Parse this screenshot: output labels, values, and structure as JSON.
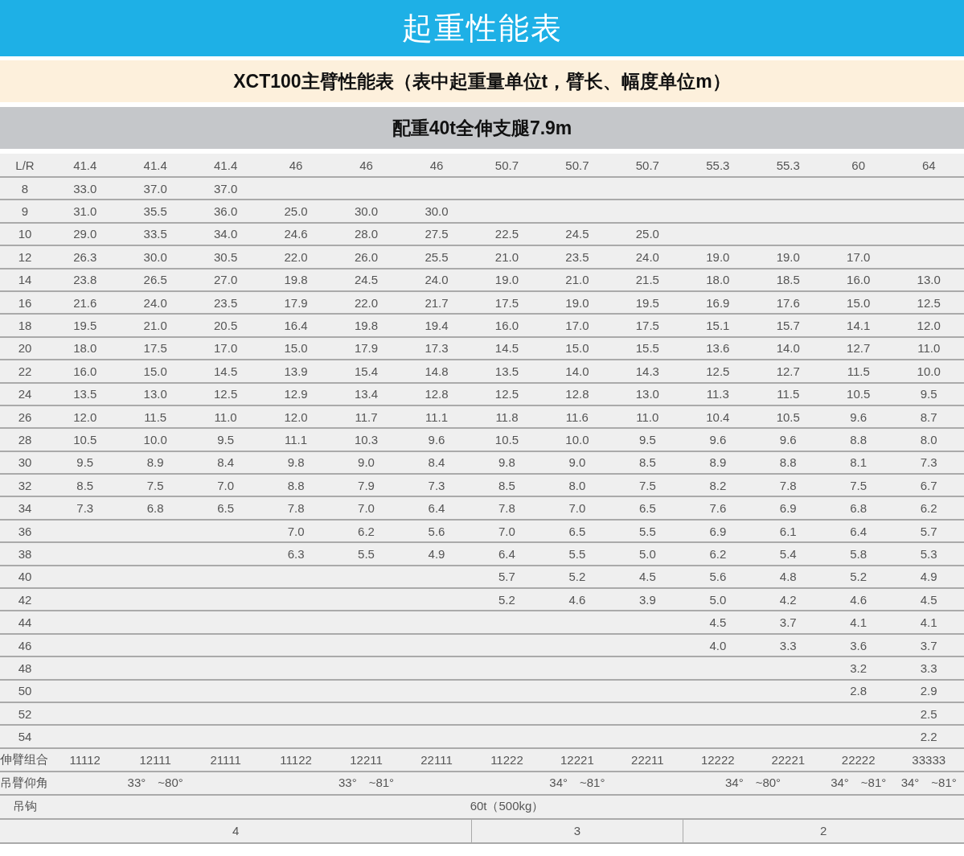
{
  "title": "起重性能表",
  "subtitle": "XCT100主臂性能表（表中起重量单位t，臂长、幅度单位m）",
  "condition": "配重40t全伸支腿7.9m",
  "table": {
    "corner": "L/R",
    "boom_lengths": [
      "41.4",
      "41.4",
      "41.4",
      "46",
      "46",
      "46",
      "50.7",
      "50.7",
      "50.7",
      "55.3",
      "55.3",
      "60",
      "64"
    ],
    "rows": [
      {
        "radius": "8",
        "values": {
          "column_1": "33.0",
          "column_2": "37.0",
          "column_3": "37.0"
        }
      },
      {
        "radius": "9",
        "values": {
          "column_1": "31.0",
          "column_2": "35.5",
          "column_3": "36.0",
          "column_4": "25.0",
          "column_5": "30.0",
          "column_6": "30.0"
        }
      },
      {
        "radius": "10",
        "values": {
          "column_1": "29.0",
          "column_2": "33.5",
          "column_3": "34.0",
          "column_4": "24.6",
          "column_5": "28.0",
          "column_6": "27.5",
          "column_7": "22.5",
          "column_8": "24.5",
          "column_9": "25.0"
        }
      },
      {
        "radius": "12",
        "values": {
          "column_1": "26.3",
          "column_2": "30.0",
          "column_3": "30.5",
          "column_4": "22.0",
          "column_5": "26.0",
          "column_6": "25.5",
          "column_7": "21.0",
          "column_8": "23.5",
          "column_9": "24.0",
          "column_10": "19.0",
          "column_11": "19.0",
          "column_12": "17.0"
        }
      },
      {
        "radius": "14",
        "values": {
          "column_1": "23.8",
          "column_2": "26.5",
          "column_3": "27.0",
          "column_4": "19.8",
          "column_5": "24.5",
          "column_6": "24.0",
          "column_7": "19.0",
          "column_8": "21.0",
          "column_9": "21.5",
          "column_10": "18.0",
          "column_11": "18.5",
          "column_12": "16.0",
          "column_13": "13.0"
        }
      },
      {
        "radius": "16",
        "values": {
          "column_1": "21.6",
          "column_2": "24.0",
          "column_3": "23.5",
          "column_4": "17.9",
          "column_5": "22.0",
          "column_6": "21.7",
          "column_7": "17.5",
          "column_8": "19.0",
          "column_9": "19.5",
          "column_10": "16.9",
          "column_11": "17.6",
          "column_12": "15.0",
          "column_13": "12.5"
        }
      },
      {
        "radius": "18",
        "values": {
          "column_1": "19.5",
          "column_2": "21.0",
          "column_3": "20.5",
          "column_4": "16.4",
          "column_5": "19.8",
          "column_6": "19.4",
          "column_7": "16.0",
          "column_8": "17.0",
          "column_9": "17.5",
          "column_10": "15.1",
          "column_11": "15.7",
          "column_12": "14.1",
          "column_13": "12.0"
        }
      },
      {
        "radius": "20",
        "values": {
          "column_1": "18.0",
          "column_2": "17.5",
          "column_3": "17.0",
          "column_4": "15.0",
          "column_5": "17.9",
          "column_6": "17.3",
          "column_7": "14.5",
          "column_8": "15.0",
          "column_9": "15.5",
          "column_10": "13.6",
          "column_11": "14.0",
          "column_12": "12.7",
          "column_13": "11.0"
        }
      },
      {
        "radius": "22",
        "values": {
          "column_1": "16.0",
          "column_2": "15.0",
          "column_3": "14.5",
          "column_4": "13.9",
          "column_5": "15.4",
          "column_6": "14.8",
          "column_7": "13.5",
          "column_8": "14.0",
          "column_9": "14.3",
          "column_10": "12.5",
          "column_11": "12.7",
          "column_12": "11.5",
          "column_13": "10.0"
        }
      },
      {
        "radius": "24",
        "values": {
          "column_1": "13.5",
          "column_2": "13.0",
          "column_3": "12.5",
          "column_4": "12.9",
          "column_5": "13.4",
          "column_6": "12.8",
          "column_7": "12.5",
          "column_8": "12.8",
          "column_9": "13.0",
          "column_10": "11.3",
          "column_11": "11.5",
          "column_12": "10.5",
          "column_13": "9.5"
        }
      },
      {
        "radius": "26",
        "values": {
          "column_1": "12.0",
          "column_2": "11.5",
          "column_3": "11.0",
          "column_4": "12.0",
          "column_5": "11.7",
          "column_6": "11.1",
          "column_7": "11.8",
          "column_8": "11.6",
          "column_9": "11.0",
          "column_10": "10.4",
          "column_11": "10.5",
          "column_12": "9.6",
          "column_13": "8.7"
        }
      },
      {
        "radius": "28",
        "values": {
          "column_1": "10.5",
          "column_2": "10.0",
          "column_3": "9.5",
          "column_4": "11.1",
          "column_5": "10.3",
          "column_6": "9.6",
          "column_7": "10.5",
          "column_8": "10.0",
          "column_9": "9.5",
          "column_10": "9.6",
          "column_11": "9.6",
          "column_12": "8.8",
          "column_13": "8.0"
        }
      },
      {
        "radius": "30",
        "values": {
          "column_1": "9.5",
          "column_2": "8.9",
          "column_3": "8.4",
          "column_4": "9.8",
          "column_5": "9.0",
          "column_6": "8.4",
          "column_7": "9.8",
          "column_8": "9.0",
          "column_9": "8.5",
          "column_10": "8.9",
          "column_11": "8.8",
          "column_12": "8.1",
          "column_13": "7.3"
        }
      },
      {
        "radius": "32",
        "values": {
          "column_1": "8.5",
          "column_2": "7.5",
          "column_3": "7.0",
          "column_4": "8.8",
          "column_5": "7.9",
          "column_6": "7.3",
          "column_7": "8.5",
          "column_8": "8.0",
          "column_9": "7.5",
          "column_10": "8.2",
          "column_11": "7.8",
          "column_12": "7.5",
          "column_13": "6.7"
        }
      },
      {
        "radius": "34",
        "values": {
          "column_1": "7.3",
          "column_2": "6.8",
          "column_3": "6.5",
          "column_4": "7.8",
          "column_5": "7.0",
          "column_6": "6.4",
          "column_7": "7.8",
          "column_8": "7.0",
          "column_9": "6.5",
          "column_10": "7.6",
          "column_11": "6.9",
          "column_12": "6.8",
          "column_13": "6.2"
        }
      },
      {
        "radius": "36",
        "values": {
          "column_4": "7.0",
          "column_5": "6.2",
          "column_6": "5.6",
          "column_7": "7.0",
          "column_8": "6.5",
          "column_9": "5.5",
          "column_10": "6.9",
          "column_11": "6.1",
          "column_12": "6.4",
          "column_13": "5.7"
        }
      },
      {
        "radius": "38",
        "values": {
          "column_4": "6.3",
          "column_5": "5.5",
          "column_6": "4.9",
          "column_7": "6.4",
          "column_8": "5.5",
          "column_9": "5.0",
          "column_10": "6.2",
          "column_11": "5.4",
          "column_12": "5.8",
          "column_13": "5.3"
        }
      },
      {
        "radius": "40",
        "values": {
          "column_7": "5.7",
          "column_8": "5.2",
          "column_9": "4.5",
          "column_10": "5.6",
          "column_11": "4.8",
          "column_12": "5.2",
          "column_13": "4.9"
        }
      },
      {
        "radius": "42",
        "values": {
          "column_7": "5.2",
          "column_8": "4.6",
          "column_9": "3.9",
          "column_10": "5.0",
          "column_11": "4.2",
          "column_12": "4.6",
          "column_13": "4.5"
        }
      },
      {
        "radius": "44",
        "values": {
          "column_10": "4.5",
          "column_11": "3.7",
          "column_12": "4.1",
          "column_13": "4.1"
        }
      },
      {
        "radius": "46",
        "values": {
          "column_10": "4.0",
          "column_11": "3.3",
          "column_12": "3.6",
          "column_13": "3.7"
        }
      },
      {
        "radius": "48",
        "values": {
          "column_12": "3.2",
          "column_13": "3.3"
        }
      },
      {
        "radius": "50",
        "values": {
          "column_12": "2.8",
          "column_13": "2.9"
        }
      },
      {
        "radius": "52",
        "values": {
          "column_13": "2.5"
        }
      },
      {
        "radius": "54",
        "values": {
          "column_13": "2.2"
        }
      }
    ],
    "combination": {
      "label": "伸臂组合",
      "values": [
        "11112",
        "12111",
        "21111",
        "11122",
        "12211",
        "22111",
        "11222",
        "12221",
        "22211",
        "12222",
        "22221",
        "22222",
        "33333"
      ]
    },
    "angle": {
      "label": "吊臂仰角",
      "groups": [
        "33°　~80°",
        "33°　~81°",
        "34°　~81°",
        "34°　~80°",
        "34°　~81°",
        "34°　~81°"
      ]
    },
    "hook": {
      "label": "吊钩",
      "text": "60t（500kg）"
    },
    "last_row": [
      "4",
      "3",
      "2"
    ]
  }
}
